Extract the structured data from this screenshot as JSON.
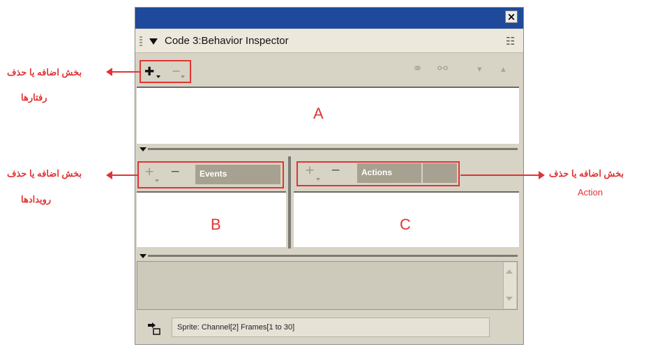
{
  "window": {
    "close_glyph": "×",
    "title": "Code 3:Behavior Inspector",
    "menu_glyph": "☷"
  },
  "toolbar": {
    "add_glyph": "✚",
    "remove_glyph": "−",
    "right_glyphs": [
      "⚭",
      "⚯",
      "▾",
      "▴"
    ]
  },
  "areas": {
    "a_label": "A",
    "b_label": "B",
    "c_label": "C"
  },
  "events": {
    "add_glyph": "+",
    "remove_glyph": "−",
    "label": "Events"
  },
  "actions": {
    "add_glyph": "+",
    "remove_glyph": "−",
    "label": "Actions"
  },
  "status": {
    "text": "Sprite:  Channel[2]  Frames[1 to 30]"
  },
  "annotations": {
    "behaviors_line1": "بخش اضافه یا حذف",
    "behaviors_line2": "رفتارها",
    "events_line1": "بخش اضافه یا حذف",
    "events_line2": "رویدادها",
    "action_line1": "بخش اضافه یا حذف",
    "action_line2": "Action"
  },
  "colors": {
    "titlebar": "#1f4a9b",
    "annotation": "#e03434",
    "panel": "#d7d3c5"
  }
}
